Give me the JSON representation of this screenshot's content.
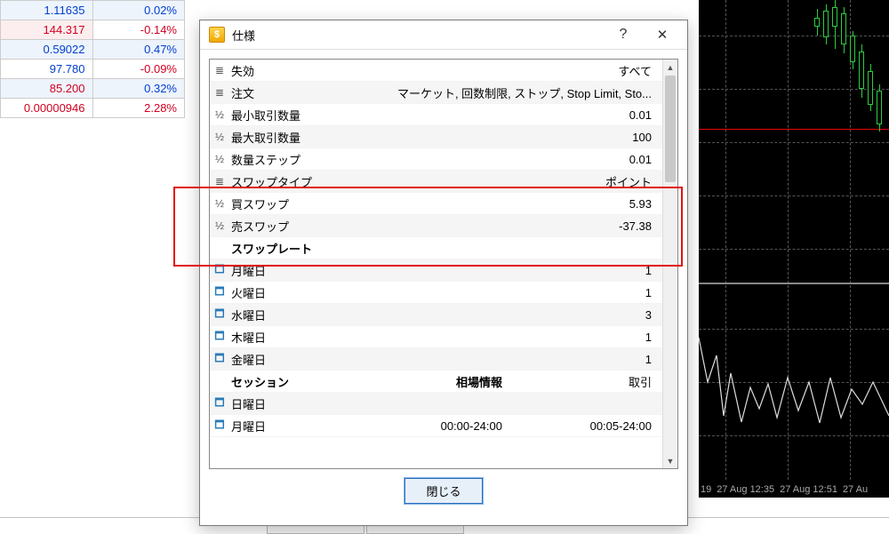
{
  "bg_rows": [
    {
      "price": "1.11635",
      "pct": "0.02%",
      "pcolor": "blue",
      "xcolor": "blue",
      "striped": true
    },
    {
      "price": "144.317",
      "pct": "-0.14%",
      "pcolor": "red",
      "xcolor": "red",
      "striped_r": true
    },
    {
      "price": "0.59022",
      "pct": "0.47%",
      "pcolor": "blue",
      "xcolor": "blue",
      "striped": true
    },
    {
      "price": "97.780",
      "pct": "-0.09%",
      "pcolor": "blue",
      "xcolor": "red"
    },
    {
      "price": "85.200",
      "pct": "0.32%",
      "pcolor": "red",
      "xcolor": "blue",
      "striped": true
    },
    {
      "price": "0.00000946",
      "pct": "2.28%",
      "pcolor": "red",
      "xcolor": "red"
    }
  ],
  "dialog": {
    "title": "仕様",
    "close_label": "閉じる",
    "help_tooltip": "?",
    "rows": [
      {
        "kind": "bars",
        "label": "失効",
        "val": "すべて",
        "alt": false
      },
      {
        "kind": "bars",
        "label": "注文",
        "val": "マーケット, 回数制限, ストップ, Stop Limit, Sto...",
        "alt": true
      },
      {
        "kind": "half",
        "label": "最小取引数量",
        "val": "0.01",
        "alt": false
      },
      {
        "kind": "half",
        "label": "最大取引数量",
        "val": "100",
        "alt": true
      },
      {
        "kind": "half",
        "label": "数量ステップ",
        "val": "0.01",
        "alt": false
      },
      {
        "kind": "bars",
        "label": "スワップタイプ",
        "val": "ポイント",
        "alt": true
      },
      {
        "kind": "half",
        "label": "買スワップ",
        "val": "5.93",
        "alt": false
      },
      {
        "kind": "half",
        "label": "売スワップ",
        "val": "-37.38",
        "alt": true
      },
      {
        "kind": "none",
        "label": "スワップレート",
        "val": "",
        "alt": false,
        "header": true
      },
      {
        "kind": "cal",
        "label": "月曜日",
        "val": "1",
        "alt": true
      },
      {
        "kind": "cal",
        "label": "火曜日",
        "val": "1",
        "alt": false
      },
      {
        "kind": "cal",
        "label": "水曜日",
        "val": "3",
        "alt": true
      },
      {
        "kind": "cal",
        "label": "木曜日",
        "val": "1",
        "alt": false
      },
      {
        "kind": "cal",
        "label": "金曜日",
        "val": "1",
        "alt": true
      },
      {
        "kind": "none",
        "label": "セッション",
        "val": "",
        "alt": false,
        "header": true,
        "col2": "相場情報",
        "col3": "取引"
      },
      {
        "kind": "cal",
        "label": "日曜日",
        "val": "",
        "alt": true
      },
      {
        "kind": "cal",
        "label": "月曜日",
        "val": "",
        "alt": false,
        "col2": "00:00-24:00",
        "col3": "00:05-24:00"
      }
    ]
  },
  "chart": {
    "xticks": [
      "19",
      "27 Aug 12:35",
      "27 Aug 12:51",
      "27 Au"
    ]
  }
}
